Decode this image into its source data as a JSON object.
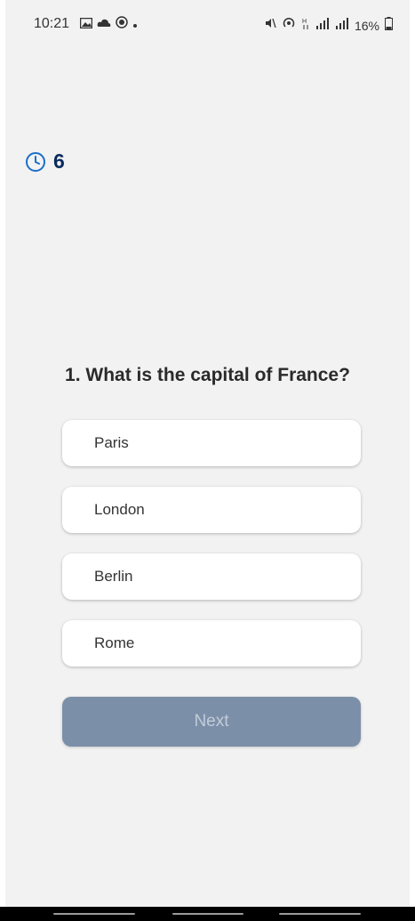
{
  "status_bar": {
    "time": "10:21",
    "battery": "16%",
    "left_icons": [
      "gallery-icon",
      "cloud-icon",
      "record-icon",
      "dot-icon"
    ],
    "right_icons": [
      "mute-icon",
      "hotspot-icon",
      "network-icon",
      "signal-icon",
      "signal-icon",
      "battery-icon"
    ]
  },
  "timer": {
    "value": "6",
    "icon": "clock-icon",
    "color": "#1a6fc9"
  },
  "question": {
    "text": "1. What is the capital of France?"
  },
  "options": [
    {
      "label": "Paris"
    },
    {
      "label": "London"
    },
    {
      "label": "Berlin"
    },
    {
      "label": "Rome"
    }
  ],
  "next_button": {
    "label": "Next",
    "background": "#7c8fa9"
  }
}
